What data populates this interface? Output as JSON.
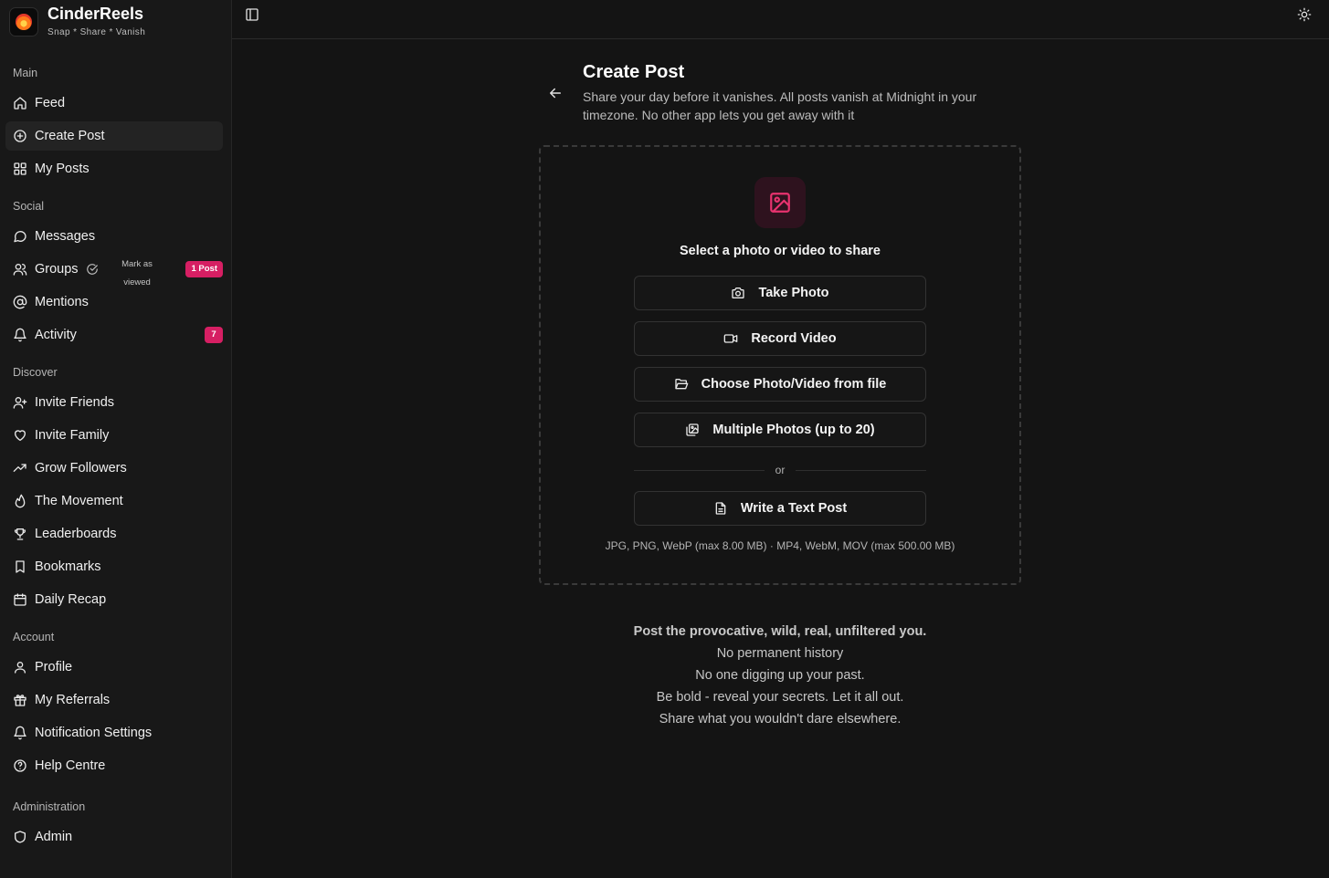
{
  "app": {
    "name": "CinderReels",
    "tagline": "Snap * Share * Vanish",
    "logo_text": "CinderReels"
  },
  "sidebar": {
    "sections": {
      "main": "Main",
      "social": "Social",
      "discover": "Discover",
      "account": "Account",
      "administration": "Administration"
    },
    "items": {
      "feed": "Feed",
      "create_post": "Create Post",
      "my_posts": "My Posts",
      "messages": "Messages",
      "groups": "Groups",
      "groups_mark_viewed": "Mark as viewed",
      "groups_badge": "1 Post",
      "mentions": "Mentions",
      "activity": "Activity",
      "activity_badge": "7",
      "invite_friends": "Invite Friends",
      "invite_family": "Invite Family",
      "grow_followers": "Grow Followers",
      "the_movement": "The Movement",
      "leaderboards": "Leaderboards",
      "bookmarks": "Bookmarks",
      "daily_recap": "Daily Recap",
      "profile": "Profile",
      "my_referrals": "My Referrals",
      "notification_settings": "Notification Settings",
      "help_centre": "Help Centre",
      "admin": "Admin"
    },
    "active_item": "create_post"
  },
  "page": {
    "title": "Create Post",
    "subtitle": "Share your day before it vanishes. All posts vanish at Midnight in your timezone. No other app lets you get away with it"
  },
  "upload": {
    "prompt": "Select a photo or video to share",
    "take_photo": "Take Photo",
    "record_video": "Record Video",
    "choose_file": "Choose Photo/Video from file",
    "multiple_photos": "Multiple Photos (up to 20)",
    "or": "or",
    "text_post": "Write a Text Post",
    "formats": "JPG, PNG, WebP (max 8.00 MB) · MP4, WebM, MOV (max 500.00 MB)"
  },
  "motto": {
    "lead": "Post the provocative, wild, real, unfiltered you.",
    "lines": [
      "No permanent history",
      "No one digging up your past.",
      "Be bold - reveal your secrets. Let it all out.",
      "Share what you wouldn't dare elsewhere."
    ]
  },
  "colors": {
    "background": "#141414",
    "sidebar": "#181818",
    "accent": "#d61f63",
    "icon_accent": "#e8336f"
  }
}
